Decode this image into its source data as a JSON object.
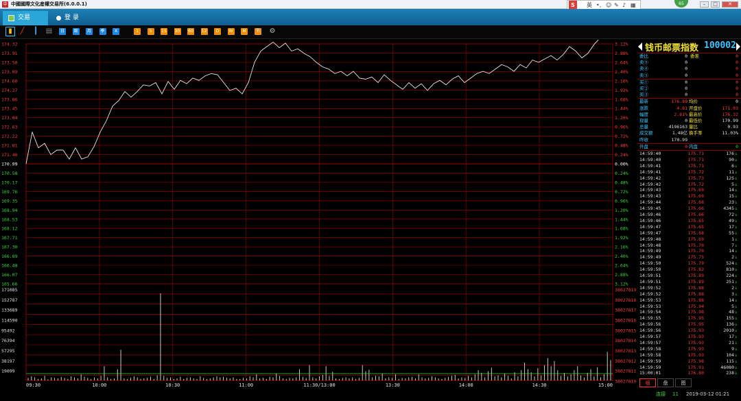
{
  "app": {
    "title": "中國國際文化産權交易所(6.0.0.1)",
    "icon_text": "中",
    "badge_count": "65"
  },
  "ime": {
    "mode": "英",
    "sep": "•,"
  },
  "menu": {
    "tabs": [
      {
        "label": "交易",
        "active": true
      },
      {
        "label": "登 录",
        "active": false
      }
    ]
  },
  "toolbar": {
    "icons": [
      {
        "name": "bar-chart-icon",
        "color": "#f0c000",
        "glyph": "▮"
      },
      {
        "name": "line-chart-icon",
        "color": "#e53935",
        "glyph": "╱"
      },
      {
        "name": "candlestick-icon",
        "color": "#3ec5ff",
        "glyph": "┃"
      },
      {
        "name": "table-icon",
        "color": "#888888",
        "glyph": "▤"
      },
      {
        "name": "day-icon",
        "color": "#1e88e5",
        "glyph": "日"
      },
      {
        "name": "week-icon",
        "color": "#1e88e5",
        "glyph": "周"
      },
      {
        "name": "month-icon",
        "color": "#1e88e5",
        "glyph": "月"
      },
      {
        "name": "season-icon",
        "color": "#1e88e5",
        "glyph": "季"
      },
      {
        "name": "x-icon",
        "color": "#1e88e5",
        "glyph": "X"
      },
      {
        "name": "period-1-icon",
        "color": "#ef8f00",
        "glyph": "1"
      },
      {
        "name": "period-5-icon",
        "color": "#ef8f00",
        "glyph": "5"
      },
      {
        "name": "period-15-icon",
        "color": "#ef8f00",
        "glyph": "15"
      },
      {
        "name": "period-30-icon",
        "color": "#ef8f00",
        "glyph": "30"
      },
      {
        "name": "period-60-icon",
        "color": "#ef8f00",
        "glyph": "60"
      },
      {
        "name": "period-120-icon",
        "color": "#ef8f00",
        "glyph": "12"
      },
      {
        "name": "period-d-icon",
        "color": "#ef8f00",
        "glyph": "D"
      },
      {
        "name": "period-w-icon",
        "color": "#ef8f00",
        "glyph": "W"
      },
      {
        "name": "period-m-icon",
        "color": "#ef8f00",
        "glyph": "M"
      },
      {
        "name": "period-y-icon",
        "color": "#ef8f00",
        "glyph": "Y"
      },
      {
        "name": "draw-icon",
        "color": "#bbbbbb",
        "glyph": "✎"
      },
      {
        "name": "settings-gear-icon",
        "color": "#bbbbbb",
        "glyph": "⚙"
      }
    ]
  },
  "chart_data": {
    "type": "line",
    "base_price": "170.99",
    "price_ticks": [
      "174.32",
      "173.91",
      "173.50",
      "173.09",
      "174.60",
      "174.27",
      "173.86",
      "173.45",
      "173.04",
      "172.63",
      "172.22",
      "171.81",
      "171.40",
      "170.99",
      "170.58",
      "170.17",
      "169.76",
      "169.35",
      "168.94",
      "168.53",
      "168.12",
      "167.71",
      "167.30",
      "166.89",
      "166.48",
      "166.07",
      "165.66"
    ],
    "pct_ticks": [
      "3.12%",
      "2.88%",
      "2.64%",
      "2.40%",
      "2.16%",
      "1.92%",
      "1.68%",
      "1.44%",
      "1.20%",
      "0.96%",
      "0.72%",
      "0.48%",
      "0.24%",
      "0.00%",
      "0.24%",
      "0.48%",
      "0.72%",
      "0.96%",
      "1.20%",
      "1.44%",
      "1.68%",
      "1.92%",
      "2.16%",
      "2.40%",
      "2.64%",
      "2.88%",
      "3.12%"
    ],
    "volume_ticks_left": [
      "171085",
      "152787",
      "133689",
      "114590",
      "95492",
      "76394",
      "57295",
      "38197",
      "19099"
    ],
    "volume_ticks_right": [
      "38027819",
      "38027818",
      "38027817",
      "38027816",
      "38027815",
      "38027814",
      "38027813",
      "38027812",
      "38027811",
      "38027810"
    ],
    "time_ticks": [
      "09:30",
      "10:00",
      "10:30",
      "11:00",
      "11:30/13:00",
      "13:30",
      "14:00",
      "14:30",
      "15:00"
    ],
    "price_series": [
      170.99,
      172.4,
      171.7,
      171.9,
      171.4,
      171.6,
      171.6,
      171.2,
      171.7,
      171.2,
      171.3,
      171.75,
      172.4,
      172.9,
      173.55,
      173.8,
      174.2,
      173.95,
      174.2,
      174.5,
      174.45,
      174.6,
      174.1,
      174.65,
      174.3,
      174.7,
      174.55,
      174.8,
      174.7,
      174.9,
      175.0,
      174.95,
      174.6,
      174.25,
      174.35,
      174.1,
      174.6,
      175.5,
      176.0,
      176.2,
      176.4,
      176.15,
      176.35,
      176.0,
      176.1,
      175.9,
      175.75,
      175.5,
      175.3,
      175.2,
      175.0,
      175.1,
      174.9,
      175.1,
      174.8,
      174.75,
      174.85,
      174.6,
      174.95,
      174.7,
      174.5,
      174.3,
      174.6,
      174.35,
      174.55,
      174.25,
      174.55,
      174.7,
      174.5,
      174.75,
      174.9,
      174.6,
      174.8,
      175.0,
      175.1,
      175.0,
      175.2,
      175.4,
      175.3,
      175.1,
      175.4,
      175.25,
      175.6,
      175.5,
      175.65,
      175.8,
      175.6,
      175.85,
      176.2,
      176.0,
      175.7,
      175.9,
      176.3,
      176.6,
      176.75,
      176.8
    ],
    "volume_series": [
      5,
      8,
      6,
      3,
      4,
      9,
      2,
      6,
      5,
      4,
      7,
      5,
      3,
      8,
      6,
      4,
      12,
      7,
      5,
      3,
      6,
      4,
      9,
      28,
      6,
      3,
      4,
      22,
      60,
      4,
      3,
      5,
      8,
      6,
      3,
      4,
      5,
      7,
      3,
      10,
      171,
      9,
      5,
      6,
      3,
      4,
      7,
      3,
      5,
      6,
      4,
      3,
      8,
      5,
      3,
      4,
      6,
      8,
      6,
      7,
      5,
      4,
      6,
      3,
      3,
      5,
      4,
      8,
      6,
      12,
      4,
      5,
      3,
      7,
      6,
      14,
      9,
      4,
      3,
      5,
      4,
      6,
      22,
      7,
      5,
      30,
      6,
      4,
      8,
      11,
      28,
      9,
      17,
      4,
      3,
      5,
      6,
      4,
      6,
      3,
      5,
      30,
      18,
      21,
      6,
      9,
      8,
      14,
      4,
      6,
      5,
      12,
      3,
      5,
      4,
      6,
      7,
      4,
      12,
      6,
      4,
      5,
      8,
      6,
      4,
      3,
      5,
      7,
      9,
      11,
      4,
      6,
      5,
      9,
      6,
      12,
      20,
      15,
      6,
      18,
      25,
      8,
      10,
      6,
      14,
      9,
      4,
      16,
      8,
      20,
      35,
      22,
      16,
      8,
      24,
      10,
      30,
      44,
      28,
      38,
      20,
      9,
      15,
      8,
      12,
      20,
      28,
      10,
      6,
      15,
      22,
      8,
      26,
      6,
      12,
      56,
      40
    ]
  },
  "panel": {
    "name": "钱币邮票指数",
    "code": "100002",
    "orderbook": [
      {
        "l": "委比",
        "v": "0",
        "l2": "委差",
        "v2": "0"
      },
      {
        "l": "卖⑤",
        "v": "0",
        "v2": "0"
      },
      {
        "l": "卖④",
        "v": "0",
        "v2": "0"
      },
      {
        "l": "卖③",
        "v": "0",
        "v2": "0"
      },
      {
        "l": "买①",
        "v": "0",
        "v2": "0"
      },
      {
        "l": "买②",
        "v": "0",
        "v2": "0"
      },
      {
        "l": "买③",
        "v": "0",
        "v2": "0"
      }
    ],
    "quote": [
      {
        "l": "最新",
        "v": "176.80",
        "l2": "均价",
        "v2": "0"
      },
      {
        "l": "涨跌",
        "v": "4.81",
        "l2": "开盘价",
        "v2": "171.03"
      },
      {
        "l": "幅度",
        "v": "2.81%",
        "l2": "最高价",
        "v2": "176.32"
      },
      {
        "l": "现量",
        "v": "0",
        "l2": "最低价",
        "v2": "170.99"
      },
      {
        "l": "总量",
        "v": "4196163",
        "l2": "量比",
        "v2": "0.93"
      },
      {
        "l": "成交额",
        "v": "1.48亿",
        "l2": "换手率",
        "v2": "11.03%"
      },
      {
        "l": "昨收",
        "v": "170.99",
        "l2": "",
        "v2": ""
      }
    ],
    "outer": {
      "l": "外盘",
      "v": "0",
      "l2": "内盘",
      "v2": "0"
    },
    "ticks": [
      [
        "14:59:40",
        "175.71",
        "176"
      ],
      [
        "14:59:40",
        "175.71",
        "90"
      ],
      [
        "14:59:41",
        "175.71",
        "6"
      ],
      [
        "14:59:41",
        "175.72",
        "11"
      ],
      [
        "14:59:42",
        "175.73",
        "125"
      ],
      [
        "14:59:42",
        "175.72",
        "5"
      ],
      [
        "14:59:43",
        "175.69",
        "14"
      ],
      [
        "14:59:43",
        "175.69",
        "15"
      ],
      [
        "14:59:44",
        "175.68",
        "23"
      ],
      [
        "14:59:45",
        "175.66",
        "4345"
      ],
      [
        "14:59:46",
        "175.66",
        "72"
      ],
      [
        "14:59:46",
        "175.65",
        "49"
      ],
      [
        "14:59:47",
        "175.65",
        "17"
      ],
      [
        "14:59:47",
        "175.68",
        "55"
      ],
      [
        "14:59:48",
        "175.69",
        "1"
      ],
      [
        "14:59:48",
        "175.70",
        "7"
      ],
      [
        "14:59:49",
        "175.70",
        "14"
      ],
      [
        "14:59:49",
        "175.75",
        "2"
      ],
      [
        "14:59:50",
        "175.79",
        "524"
      ],
      [
        "14:59:50",
        "175.82",
        "810"
      ],
      [
        "14:59:51",
        "175.89",
        "224"
      ],
      [
        "14:59:51",
        "175.89",
        "251"
      ],
      [
        "14:59:52",
        "175.88",
        "2"
      ],
      [
        "14:59:52",
        "175.88",
        "3"
      ],
      [
        "14:59:53",
        "175.88",
        "14"
      ],
      [
        "14:59:53",
        "175.94",
        "5"
      ],
      [
        "14:59:54",
        "175.98",
        "48"
      ],
      [
        "14:59:55",
        "175.95",
        "155"
      ],
      [
        "14:59:56",
        "175.95",
        "136"
      ],
      [
        "14:59:56",
        "175.93",
        "2010"
      ],
      [
        "14:59:57",
        "175.93",
        "17"
      ],
      [
        "14:59:57",
        "175.93",
        "21"
      ],
      [
        "14:59:58",
        "175.93",
        "9"
      ],
      [
        "14:59:58",
        "175.93",
        "104"
      ],
      [
        "14:59:59",
        "175.98",
        "115"
      ],
      [
        "14:59:59",
        "175.91",
        "46080"
      ],
      [
        "15:00:01",
        "176.80",
        "238"
      ]
    ],
    "tabs": [
      "细",
      "盘",
      "图"
    ]
  },
  "status": {
    "conn": "连接",
    "count": "11",
    "datetime": "2019-03-12 01:21"
  },
  "colors": {
    "grid": "#8b0000",
    "up": "#ff3b3b",
    "down": "#3ad63a",
    "price": "#e8e8e8",
    "volume": "#e0e0e0",
    "avg": "#3ad63a"
  }
}
